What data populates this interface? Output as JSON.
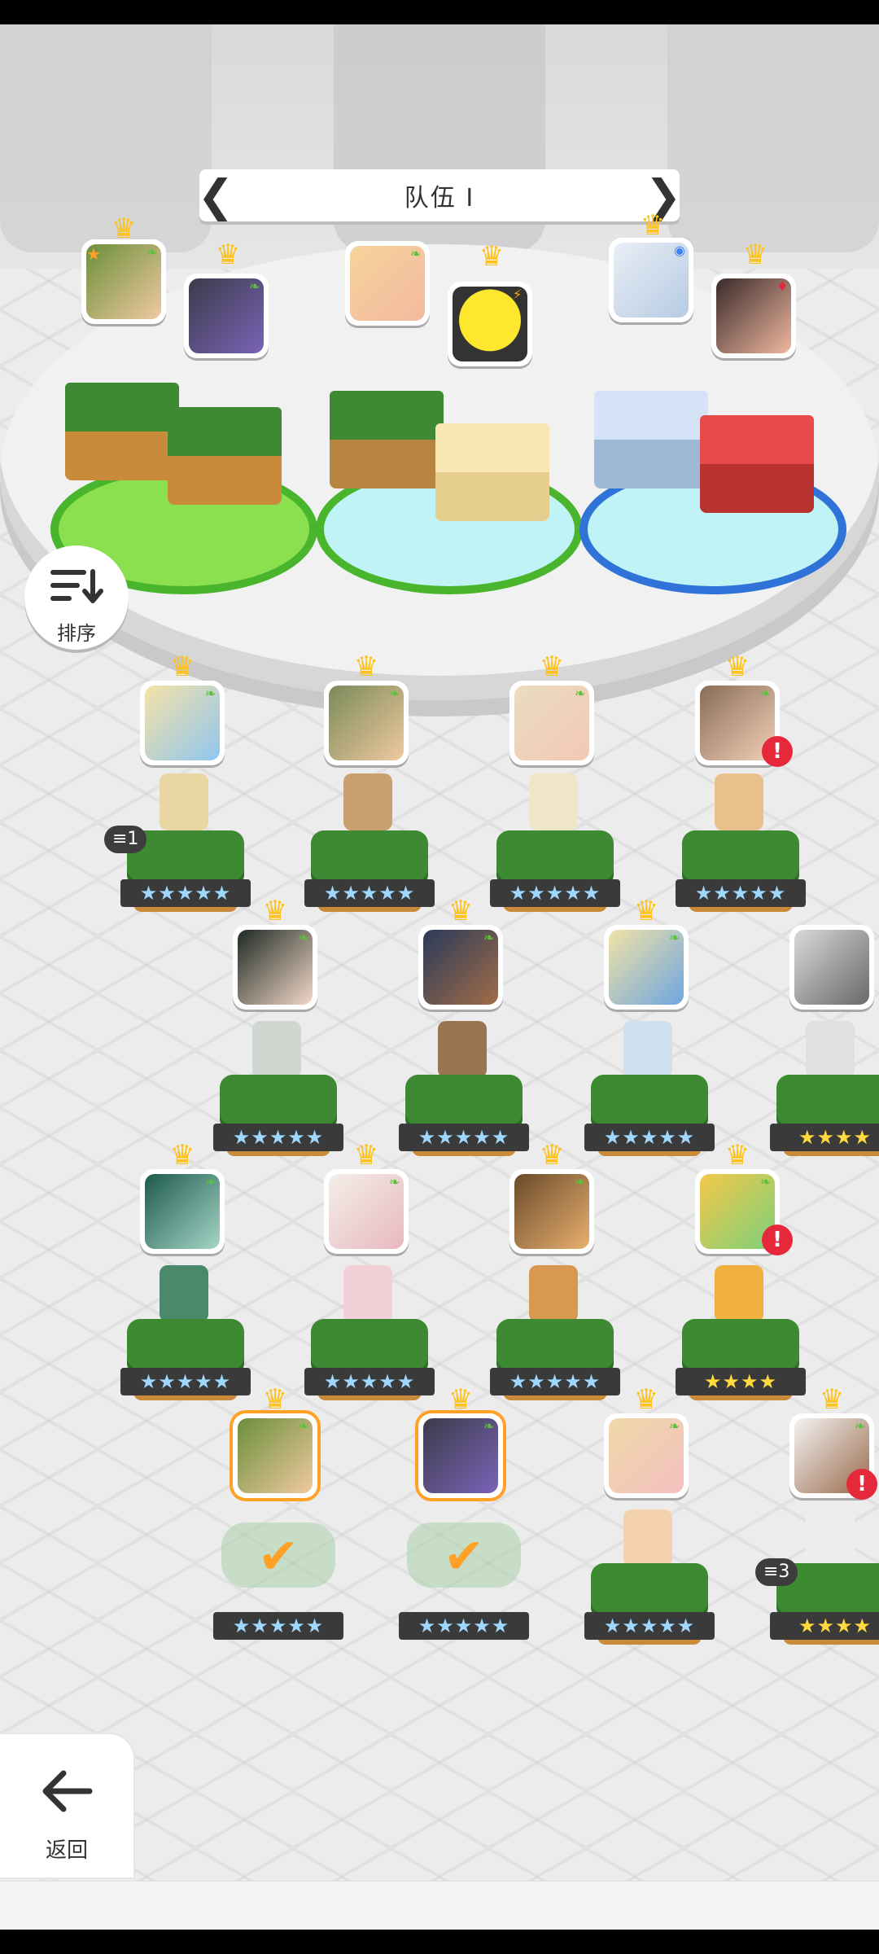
{
  "header": {
    "title": "队伍 I",
    "prev_label": "❮",
    "next_label": "❯"
  },
  "controls": {
    "sort_label": "排序",
    "back_label": "返回"
  },
  "team_slots": [
    {
      "star": "★",
      "element": "leaf"
    },
    {
      "element": "leaf"
    },
    {
      "element": "leaf"
    },
    {
      "element": "lightning"
    },
    {
      "element": "water"
    },
    {
      "element": "fire"
    }
  ],
  "roster": {
    "row1": [
      {
        "stars": "★★★★★",
        "badge": "≡1"
      },
      {
        "stars": "★★★★★"
      },
      {
        "stars": "★★★★★"
      },
      {
        "stars": "★★★★★",
        "alert": "!"
      }
    ],
    "row2": [
      {
        "stars": "★★★★★"
      },
      {
        "stars": "★★★★★"
      },
      {
        "stars": "★★★★★"
      },
      {
        "stars": "★★★★"
      }
    ],
    "row3": [
      {
        "stars": "★★★★★"
      },
      {
        "stars": "★★★★★"
      },
      {
        "stars": "★★★★★"
      },
      {
        "stars": "★★★★",
        "alert": "!"
      }
    ],
    "row4": [
      {
        "stars": "★★★★★",
        "selected": "✔"
      },
      {
        "stars": "★★★★★",
        "selected": "✔"
      },
      {
        "stars": "★★★★★"
      },
      {
        "stars": "★★★★",
        "badge": "≡3",
        "alert": "!"
      }
    ]
  },
  "colors": {
    "accent_orange": "#ffa126",
    "crown": "#ffc21a",
    "alert_red": "#e5283a",
    "grass": "#3e8a33"
  }
}
